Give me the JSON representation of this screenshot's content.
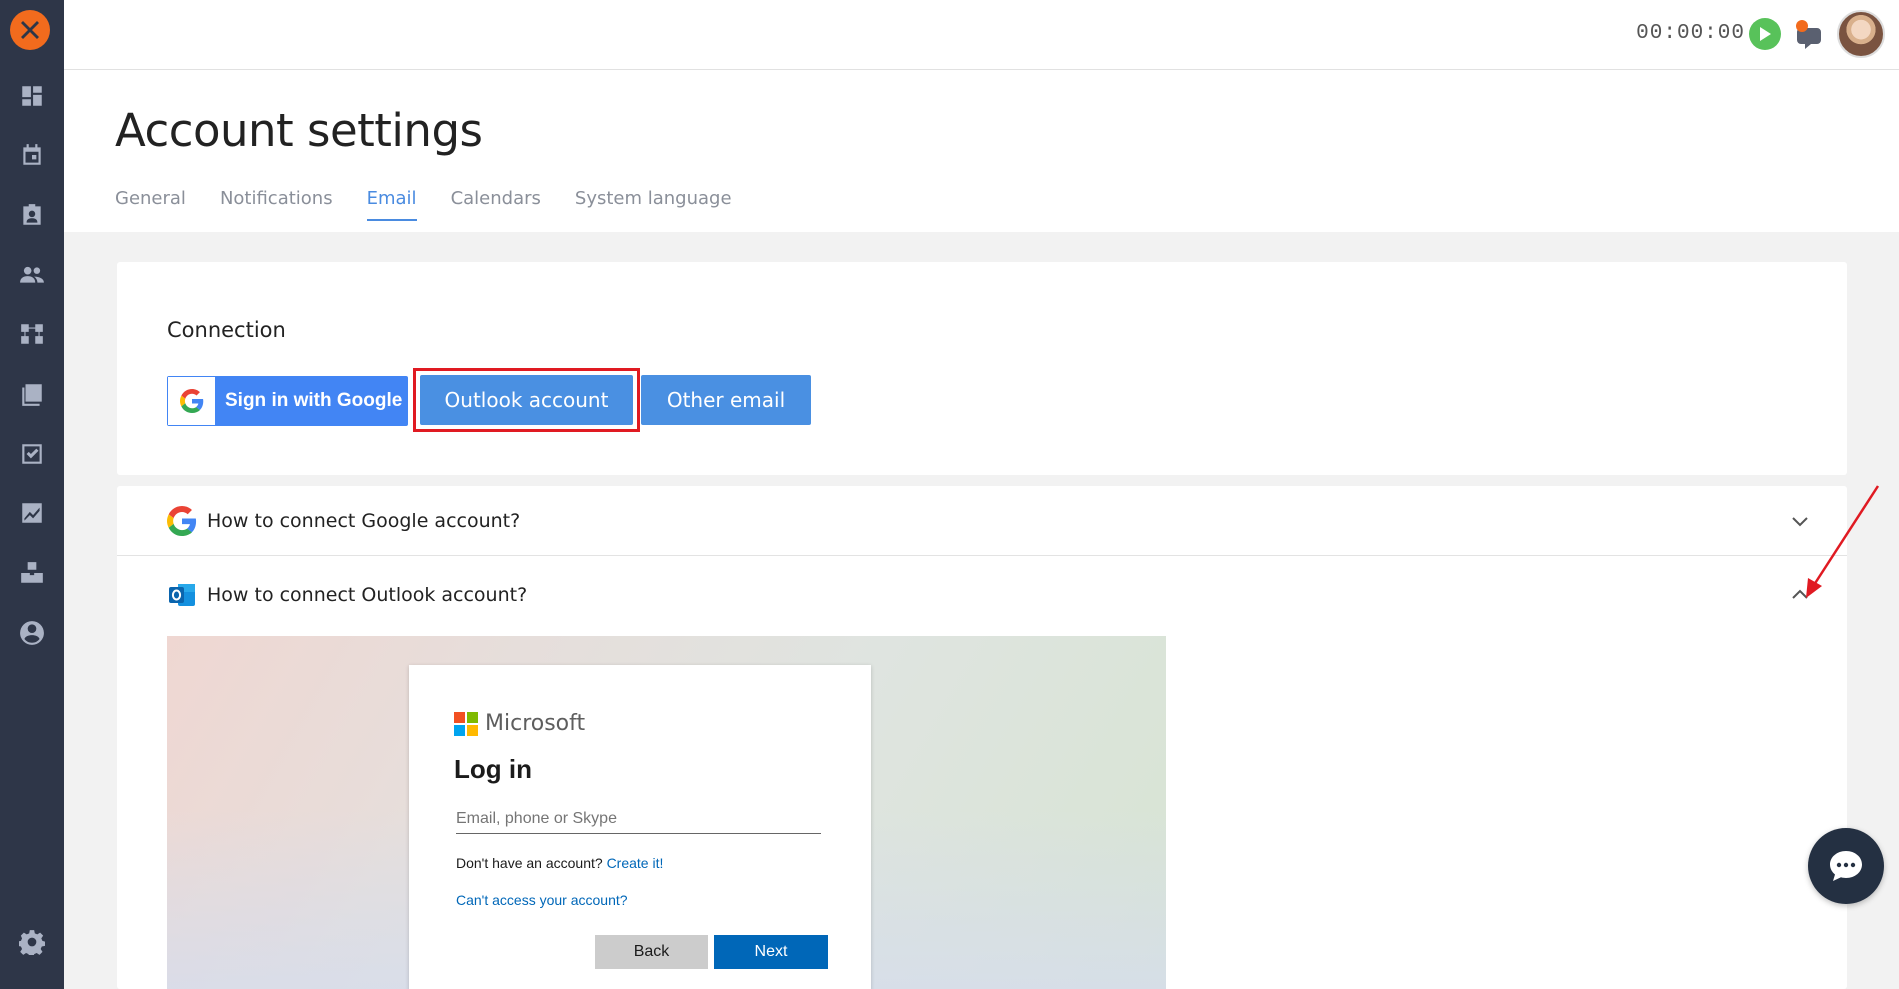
{
  "header": {
    "title": "Account settings",
    "tabs": [
      {
        "label": "General"
      },
      {
        "label": "Notifications"
      },
      {
        "label": "Email",
        "active": true
      },
      {
        "label": "Calendars"
      },
      {
        "label": "System language"
      }
    ]
  },
  "topbar": {
    "timer": "00:00:00"
  },
  "sidebar": {
    "icons": [
      "dashboard-icon",
      "calendar-icon",
      "contacts-icon",
      "people-icon",
      "flow-icon",
      "book-icon",
      "task-icon",
      "chart-icon",
      "boxes-icon",
      "user-circle-icon",
      "gear-icon"
    ]
  },
  "connection": {
    "title": "Connection",
    "google_button": "Sign in with Google",
    "outlook_button": "Outlook account",
    "other_button": "Other email"
  },
  "accordion": {
    "items": [
      {
        "label": "How to connect Google account?",
        "expanded": false
      },
      {
        "label": "How to connect Outlook account?",
        "expanded": true
      }
    ]
  },
  "ms_login": {
    "brand": "Microsoft",
    "heading": "Log in",
    "input_placeholder": "Email, phone or Skype",
    "no_account_text": "Don't have an account? ",
    "create_link": "Create it!",
    "cant_access": "Can't access your account?",
    "back_label": "Back",
    "next_label": "Next"
  },
  "colors": {
    "sidebar_bg": "#2e3648",
    "accent": "#4a90e2",
    "highlight": "#e01a22",
    "logo": "#f26b1d"
  }
}
